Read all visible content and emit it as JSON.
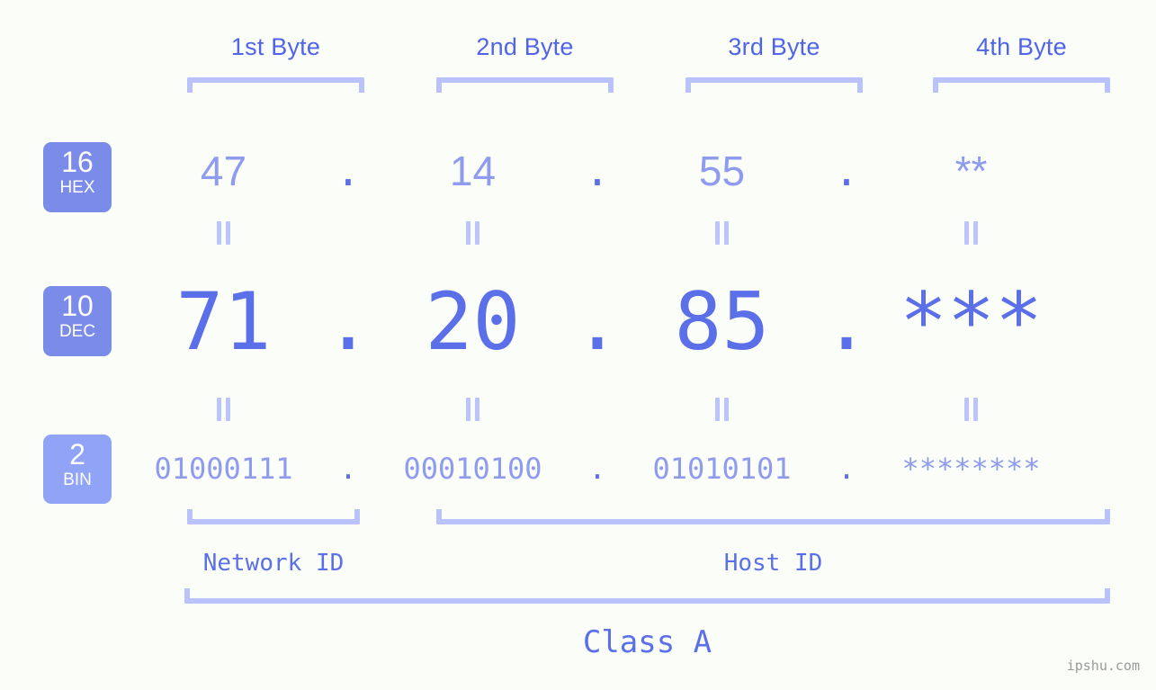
{
  "meta": {
    "background_color": "#fbfdf9",
    "accent_strong": "#5a6fe8",
    "accent_light": "#8e9bee",
    "bracket_color": "#b9c2fb",
    "badge_color": "#7b8bea",
    "badge_color_bin": "#90a3f7",
    "watermark": "ipshu.com"
  },
  "byte_headers": [
    {
      "label": "1st Byte"
    },
    {
      "label": "2nd Byte"
    },
    {
      "label": "3rd Byte"
    },
    {
      "label": "4th Byte"
    }
  ],
  "bases": [
    {
      "radix": "16",
      "name": "HEX"
    },
    {
      "radix": "10",
      "name": "DEC"
    },
    {
      "radix": "2",
      "name": "BIN"
    }
  ],
  "rows": {
    "hex": {
      "radix": "16",
      "name": "HEX",
      "values": [
        "47",
        "14",
        "55",
        "**"
      ],
      "separator": "."
    },
    "dec": {
      "radix": "10",
      "name": "DEC",
      "values": [
        "71",
        "20",
        "85",
        "***"
      ],
      "separator": "."
    },
    "bin": {
      "radix": "2",
      "name": "BIN",
      "values": [
        "01000111",
        "00010100",
        "01010101",
        "********"
      ],
      "separator": "."
    }
  },
  "segments": {
    "network_id": "Network ID",
    "host_id": "Host ID",
    "class": "Class A"
  },
  "equals_symbol": "||"
}
